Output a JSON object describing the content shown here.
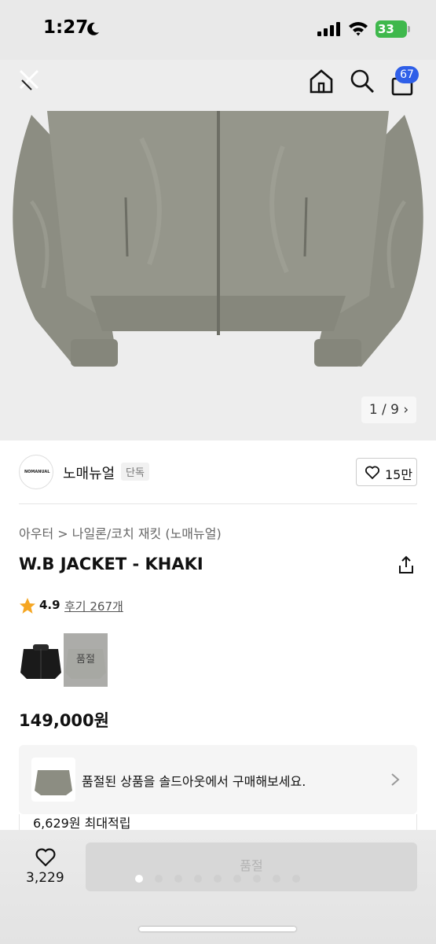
{
  "status_bar": {
    "time": "1:27",
    "battery": "33"
  },
  "header": {
    "cart_count": "67"
  },
  "gallery": {
    "page_indicator": "1 / 9 ›"
  },
  "brand": {
    "name": "노매뉴얼",
    "tag": "단독",
    "likes": "15만",
    "logo_text": "NOMANUAL"
  },
  "breadcrumb": "아우터 > 나일론/코치 재킷 (노매뉴얼)",
  "product": {
    "title": "W.B JACKET - KHAKI",
    "rating": "4.9",
    "reviews": "후기 267개",
    "price": "149,000원"
  },
  "variants": [
    {
      "color": "black",
      "sold_out": false
    },
    {
      "color": "khaki",
      "sold_out": true,
      "label": "품절"
    }
  ],
  "soldout_banner": {
    "text": "품절된 상품을 솔드아웃에서 구매해보세요."
  },
  "points": {
    "text": "6,629원 최대적립"
  },
  "bottom_bar": {
    "wish_count": "3,229",
    "buy_label": "품절"
  },
  "carousel": {
    "total_dots": 9,
    "active_dot": 1
  },
  "colors": {
    "accent_blue": "#2f5fe8",
    "star": "#f5a623",
    "battery_green": "#3fb84c"
  }
}
